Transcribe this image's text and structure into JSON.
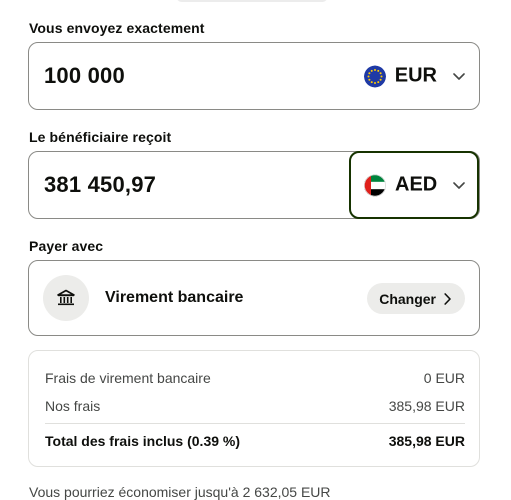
{
  "send": {
    "label": "Vous envoyez exactement",
    "amount": "100 000",
    "currency_code": "EUR",
    "currency_icon": "eu-flag-icon"
  },
  "receive": {
    "label": "Le bénéficiaire reçoit",
    "amount": "381 450,97",
    "currency_code": "AED",
    "currency_icon": "uae-flag-icon"
  },
  "payment": {
    "label": "Payer avec",
    "method": "Virement bancaire",
    "method_icon": "bank-icon",
    "change_label": "Changer"
  },
  "fees": {
    "rows": [
      {
        "label": "Frais de virement bancaire",
        "value": "0 EUR"
      },
      {
        "label": "Nos frais",
        "value": "385,98 EUR"
      }
    ],
    "total_label": "Total des frais inclus (0.39 %)",
    "total_value": "385,98 EUR"
  },
  "savings_text": "Vous pourriez économiser jusqu'à 2 632,05 EUR",
  "colors": {
    "selected_border": "#163300",
    "chip_background": "#ececea",
    "border": "#8a8a86"
  }
}
